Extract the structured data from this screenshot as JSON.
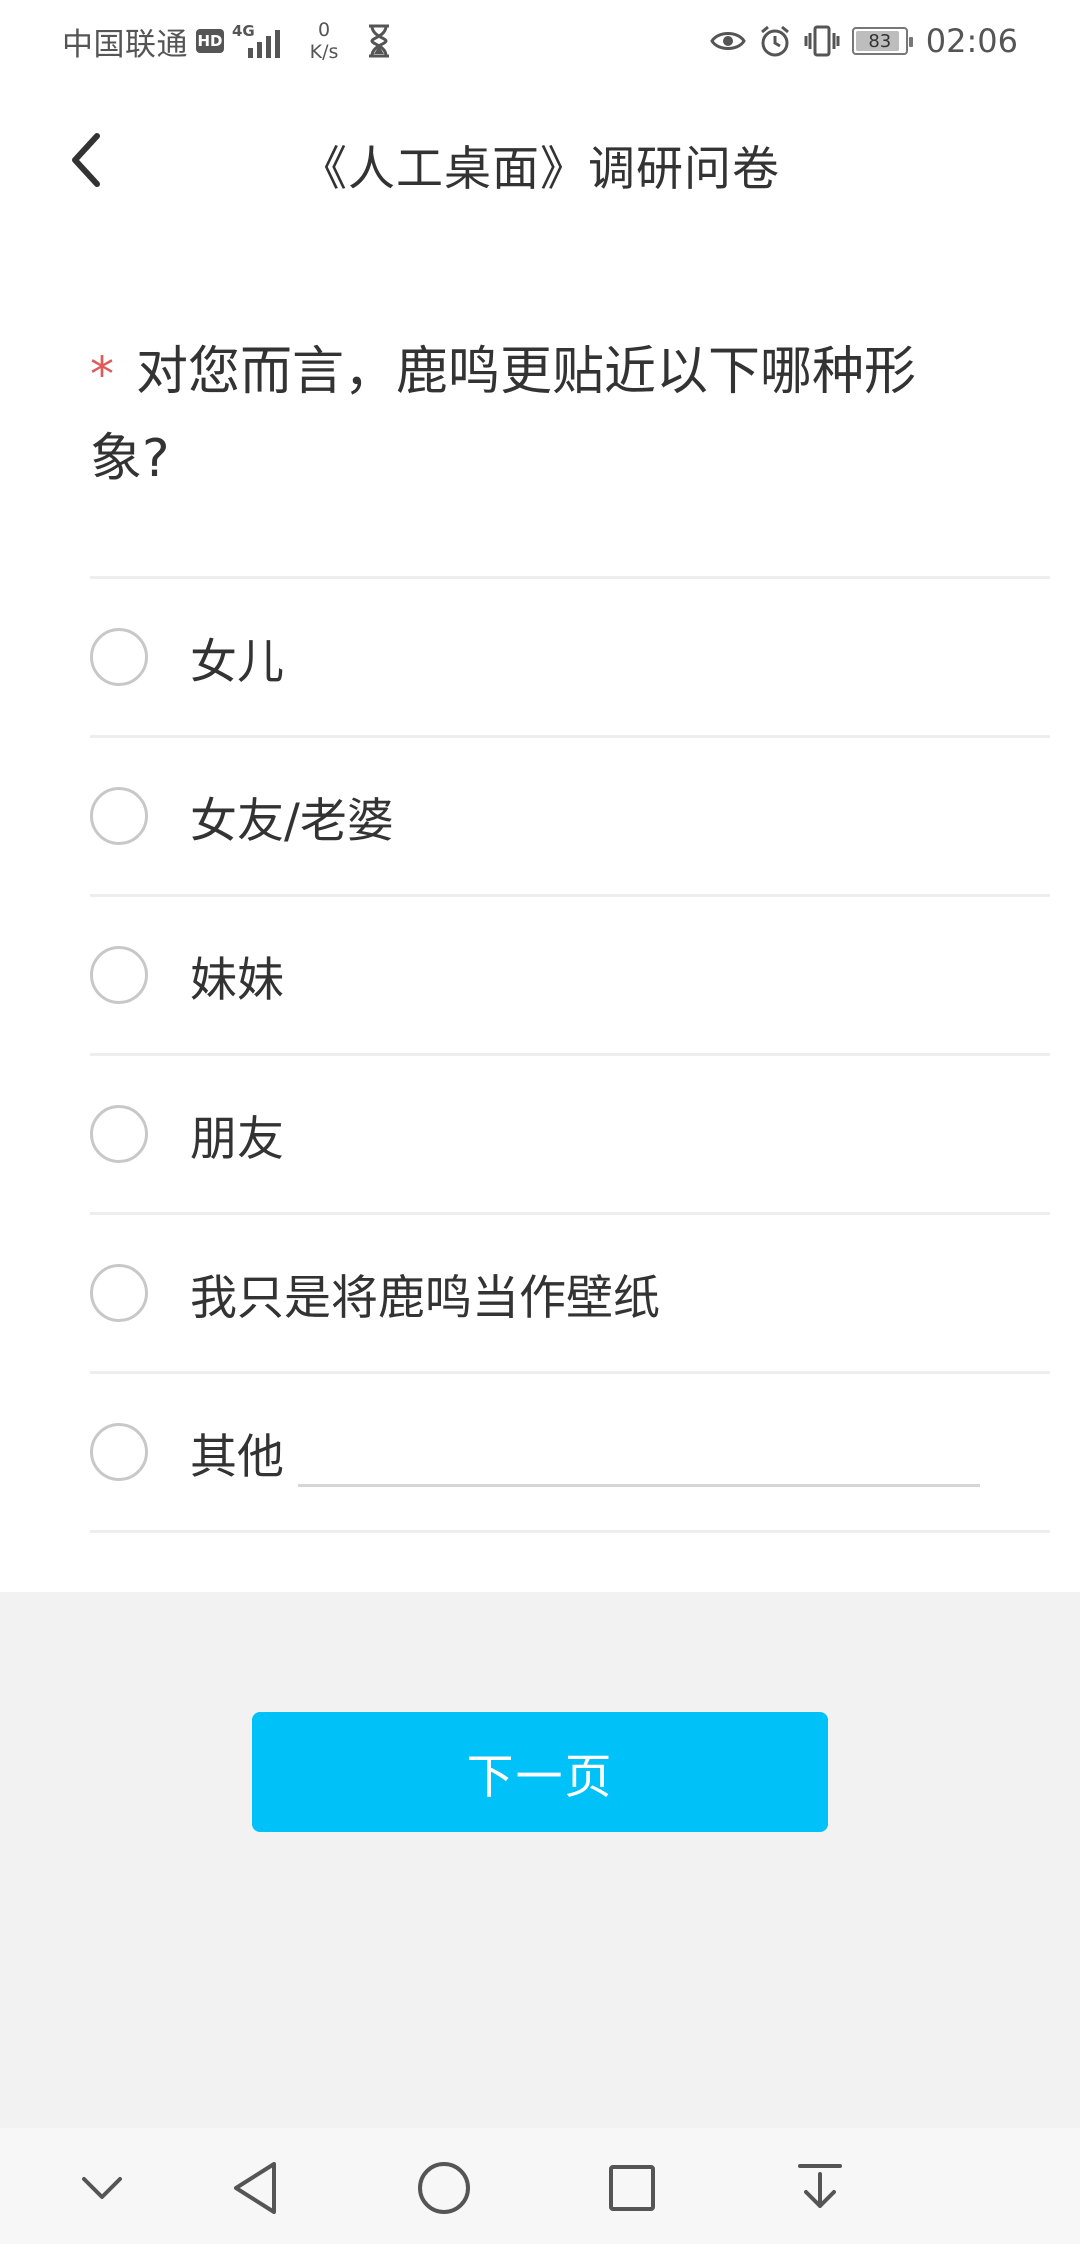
{
  "status_bar": {
    "carrier": "中国联通",
    "hd": "HD",
    "network": "4G",
    "speed_value": "0",
    "speed_unit": "K/s",
    "battery": "83",
    "time": "02:06"
  },
  "header": {
    "title": "《人工桌面》调研问卷"
  },
  "question": {
    "required_mark": "*",
    "text": "对您而言，鹿鸣更贴近以下哪种形象?"
  },
  "options": [
    {
      "label": "女儿"
    },
    {
      "label": "女友/老婆"
    },
    {
      "label": "妹妹"
    },
    {
      "label": "朋友"
    },
    {
      "label": "我只是将鹿鸣当作壁纸"
    },
    {
      "label": "其他"
    }
  ],
  "footer": {
    "next_label": "下一页"
  },
  "colors": {
    "accent": "#00c1f8",
    "required": "#e05a5a",
    "footer_bg": "#f2f2f2"
  },
  "icons": [
    "back-chevron-icon",
    "eye-icon",
    "alarm-icon",
    "vibrate-icon",
    "hourglass-icon",
    "nav-collapse-icon",
    "nav-back-icon",
    "nav-home-icon",
    "nav-recents-icon",
    "nav-notification-icon"
  ]
}
